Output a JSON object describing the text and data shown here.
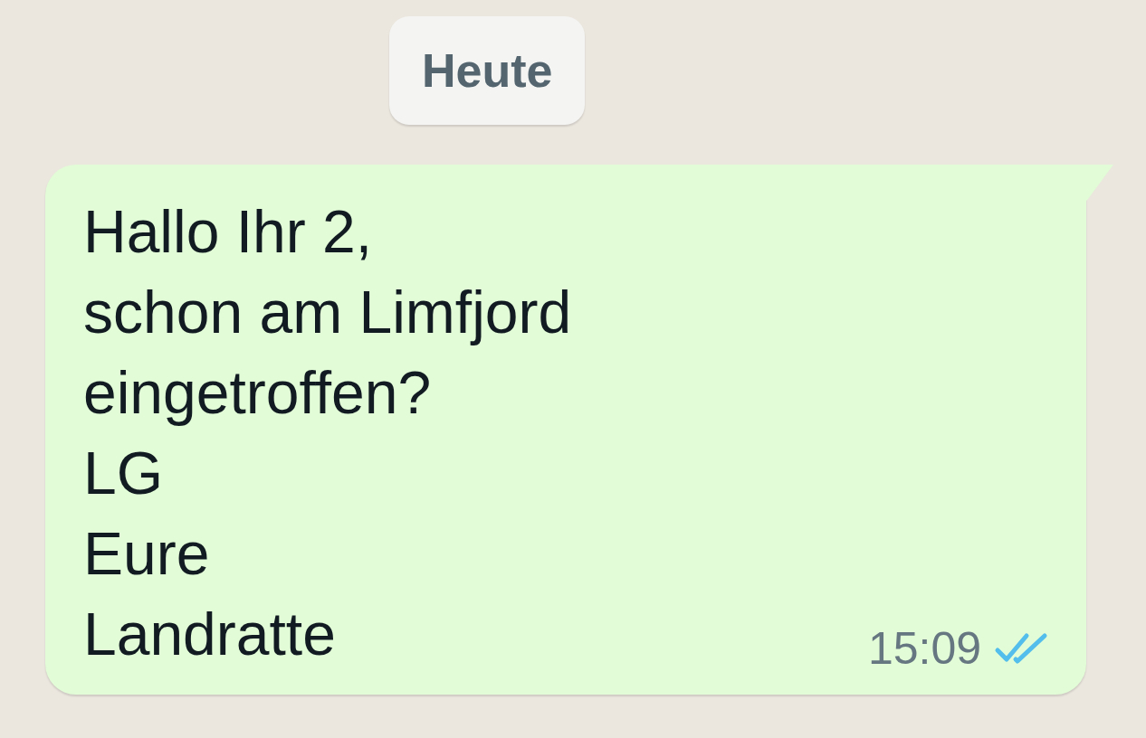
{
  "date_chip": "Heute",
  "messages": [
    {
      "text": "Hallo Ihr 2,\nschon am Limfjord\neingetroffen?\nLG\nEure\nLandratte",
      "time": "15:09",
      "read": true
    }
  ]
}
